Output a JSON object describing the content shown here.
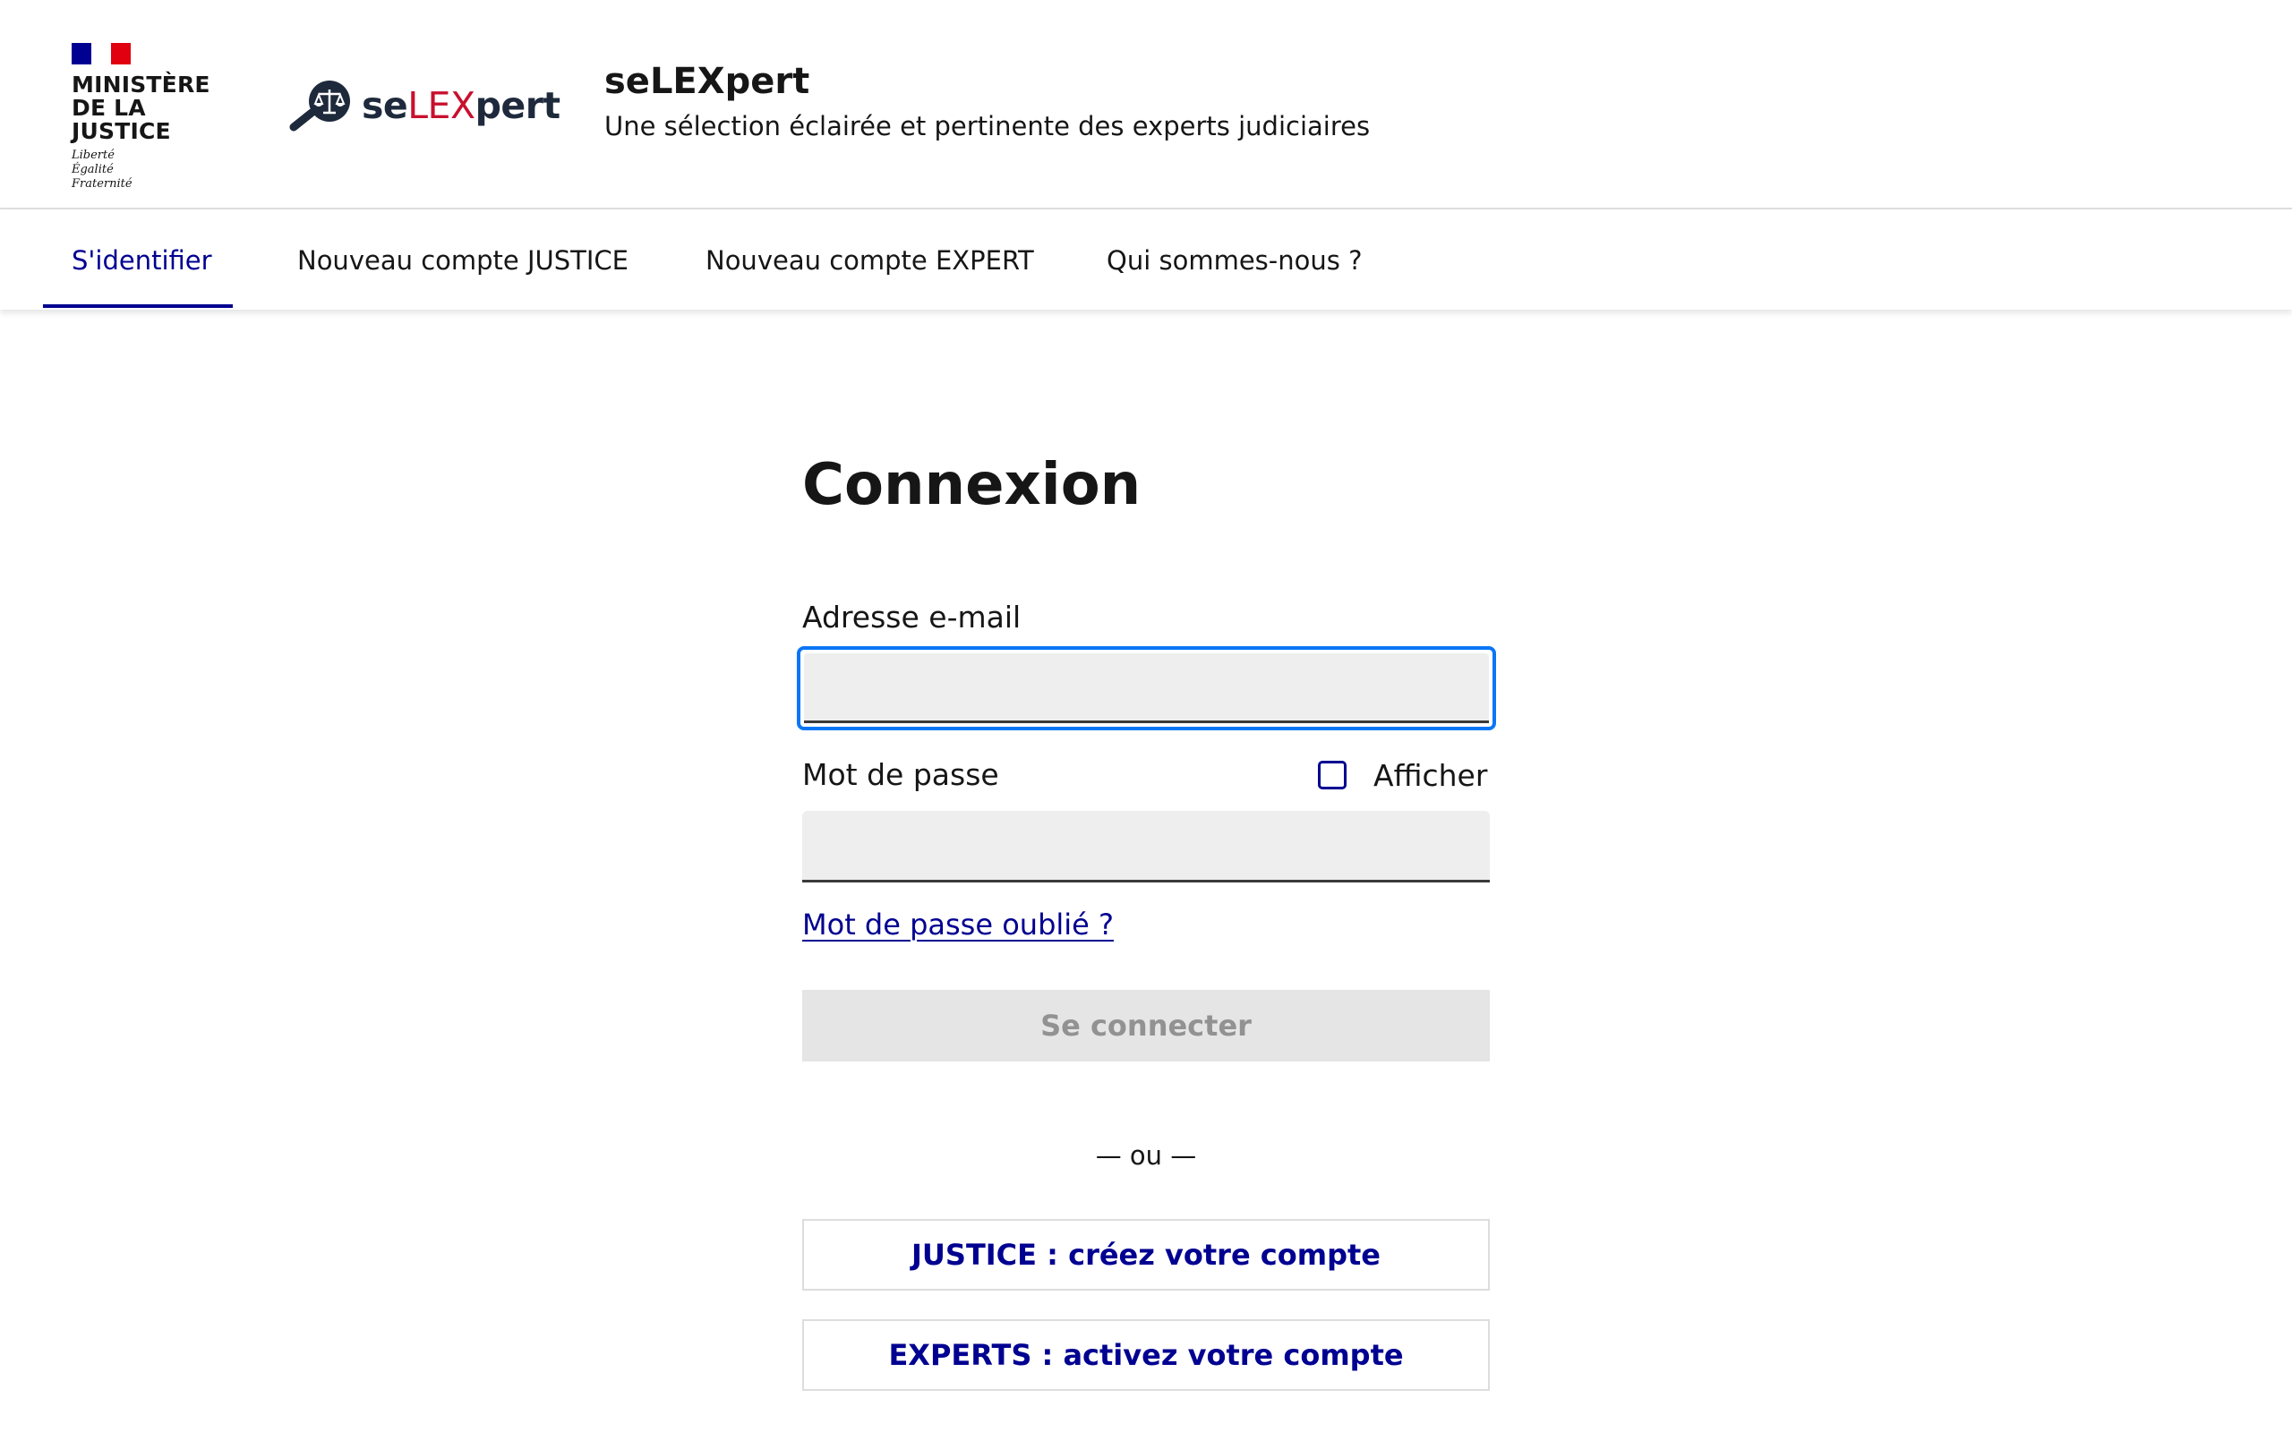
{
  "header": {
    "ministry_name": "MINISTÈRE DE LA JUSTICE",
    "motto": [
      "Liberté",
      "Égalité",
      "Fraternité"
    ],
    "brand": {
      "part1": "se",
      "part2": "LEX",
      "part3": "pert"
    },
    "service_title": "seLEXpert",
    "service_tagline": "Une sélection éclairée et pertinente des experts judiciaires"
  },
  "nav": {
    "items": [
      {
        "label": "S'identifier",
        "active": true
      },
      {
        "label": "Nouveau compte JUSTICE",
        "active": false
      },
      {
        "label": "Nouveau compte EXPERT",
        "active": false
      },
      {
        "label": "Qui sommes-nous ?",
        "active": false
      }
    ]
  },
  "form": {
    "title": "Connexion",
    "email_label": "Adresse e-mail",
    "email_value": "",
    "password_label": "Mot de passe",
    "password_value": "",
    "show_password_label": "Afficher",
    "show_password_checked": false,
    "forgot_link": "Mot de passe oublié ?",
    "submit_label": "Se connecter",
    "separator": "— ou —",
    "justice_button": "JUSTICE : créez votre compte",
    "experts_button": "EXPERTS : activez votre compte"
  },
  "colors": {
    "primary_blue": "#000091",
    "focus_blue": "#0a76f6",
    "brand_red": "#c8102e",
    "flag_red": "#e1000f",
    "disabled_bg": "#e5e5e5",
    "input_bg": "#eeeeee"
  },
  "icons": {
    "brand_icon": "magnifier-scales-icon",
    "checkbox": "checkbox-icon"
  }
}
